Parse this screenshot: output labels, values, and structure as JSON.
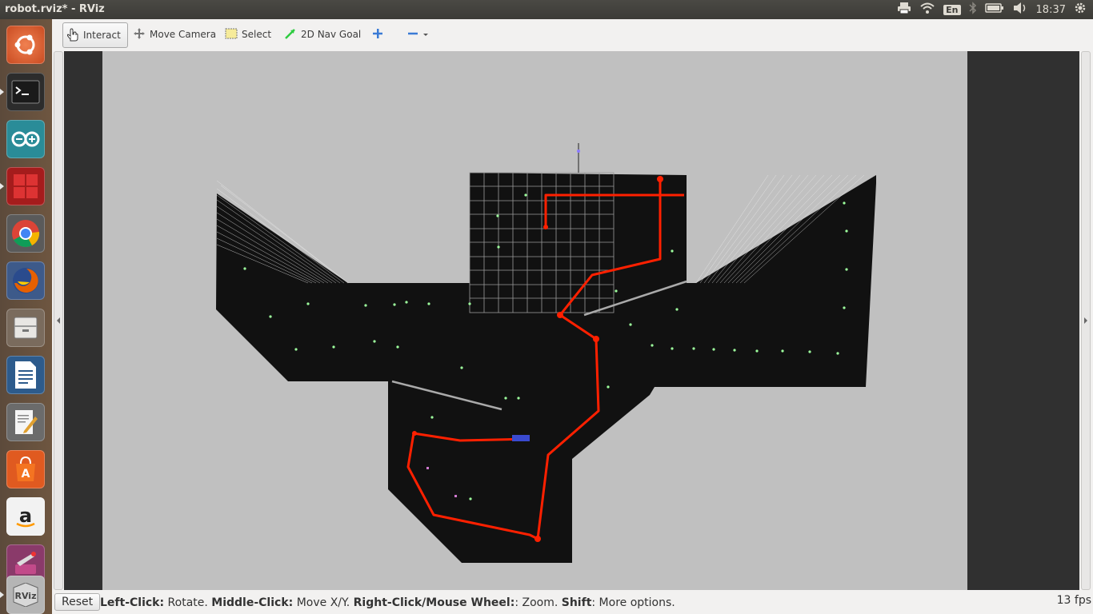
{
  "window": {
    "title": "robot.rviz* - RViz"
  },
  "tray": {
    "language": "En",
    "clock": "18:37"
  },
  "launcher": {
    "items": [
      {
        "name": "ubuntu-dash-icon"
      },
      {
        "name": "terminal-icon"
      },
      {
        "name": "arduino-icon"
      },
      {
        "name": "workspace-icon"
      },
      {
        "name": "chrome-icon"
      },
      {
        "name": "firefox-icon"
      },
      {
        "name": "files-icon"
      },
      {
        "name": "writer-icon"
      },
      {
        "name": "text-editor-icon"
      },
      {
        "name": "software-center-icon"
      },
      {
        "name": "amazon-icon"
      },
      {
        "name": "system-settings-icon"
      },
      {
        "name": "rviz-icon"
      }
    ]
  },
  "toolbar": {
    "interact_label": "Interact",
    "move_camera_label": "Move Camera",
    "select_label": "Select",
    "nav_goal_label": "2D Nav Goal"
  },
  "status": {
    "reset_label": "Reset",
    "hint_left_key": "Left-Click:",
    "hint_left_val": " Rotate. ",
    "hint_mid_key": "Middle-Click:",
    "hint_mid_val": " Move X/Y. ",
    "hint_right_key": "Right-Click/Mouse Wheel:",
    "hint_right_val": ": Zoom. ",
    "hint_shift_key": "Shift",
    "hint_shift_val": ": More options.",
    "fps": "13 fps"
  },
  "colors": {
    "map_unknown": "#c0c0c0",
    "map_free": "#111111",
    "path": "#ff2000",
    "landmark": "#9dff9d",
    "accent": "#e95420"
  }
}
